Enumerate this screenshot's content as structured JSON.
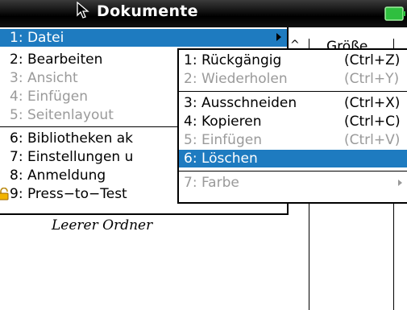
{
  "window": {
    "title": "Dokumente"
  },
  "background": {
    "column_header_size": "Größe",
    "empty_folder_text": "Leerer Ordner"
  },
  "menu": {
    "items": [
      {
        "label": "1: Datei",
        "state": "selected",
        "has_submenu": true
      },
      {
        "label": "2: Bearbeiten",
        "state": "normal"
      },
      {
        "label": "3: Ansicht",
        "state": "disabled"
      },
      {
        "label": "4: Einfügen",
        "state": "disabled"
      },
      {
        "label": "5: Seitenlayout",
        "state": "disabled"
      },
      {
        "label": "6: Bibliotheken ak",
        "state": "normal"
      },
      {
        "label": "7: Einstellungen u",
        "state": "normal"
      },
      {
        "label": "8: Anmeldung",
        "state": "normal"
      },
      {
        "label": "9: Press−to−Test",
        "state": "normal",
        "has_submenu": true,
        "icon": "lock-icon"
      }
    ]
  },
  "submenu": {
    "items": [
      {
        "label": "1: Rückgängig",
        "shortcut": "(Ctrl+Z)",
        "state": "normal"
      },
      {
        "label": "2: Wiederholen",
        "shortcut": "(Ctrl+Y)",
        "state": "disabled"
      },
      {
        "label": "3: Ausschneiden",
        "shortcut": "(Ctrl+X)",
        "state": "normal"
      },
      {
        "label": "4: Kopieren",
        "shortcut": "(Ctrl+C)",
        "state": "normal"
      },
      {
        "label": "5: Einfügen",
        "shortcut": "(Ctrl+V)",
        "state": "disabled"
      },
      {
        "label": "6: Löschen",
        "shortcut": "",
        "state": "selected"
      },
      {
        "label": "7: Farbe",
        "shortcut": "",
        "state": "disabled",
        "has_submenu": true
      }
    ]
  },
  "colors": {
    "selection": "#1e7bc0",
    "disabled_text": "#9a9a9a",
    "title_bar": "#000000"
  }
}
